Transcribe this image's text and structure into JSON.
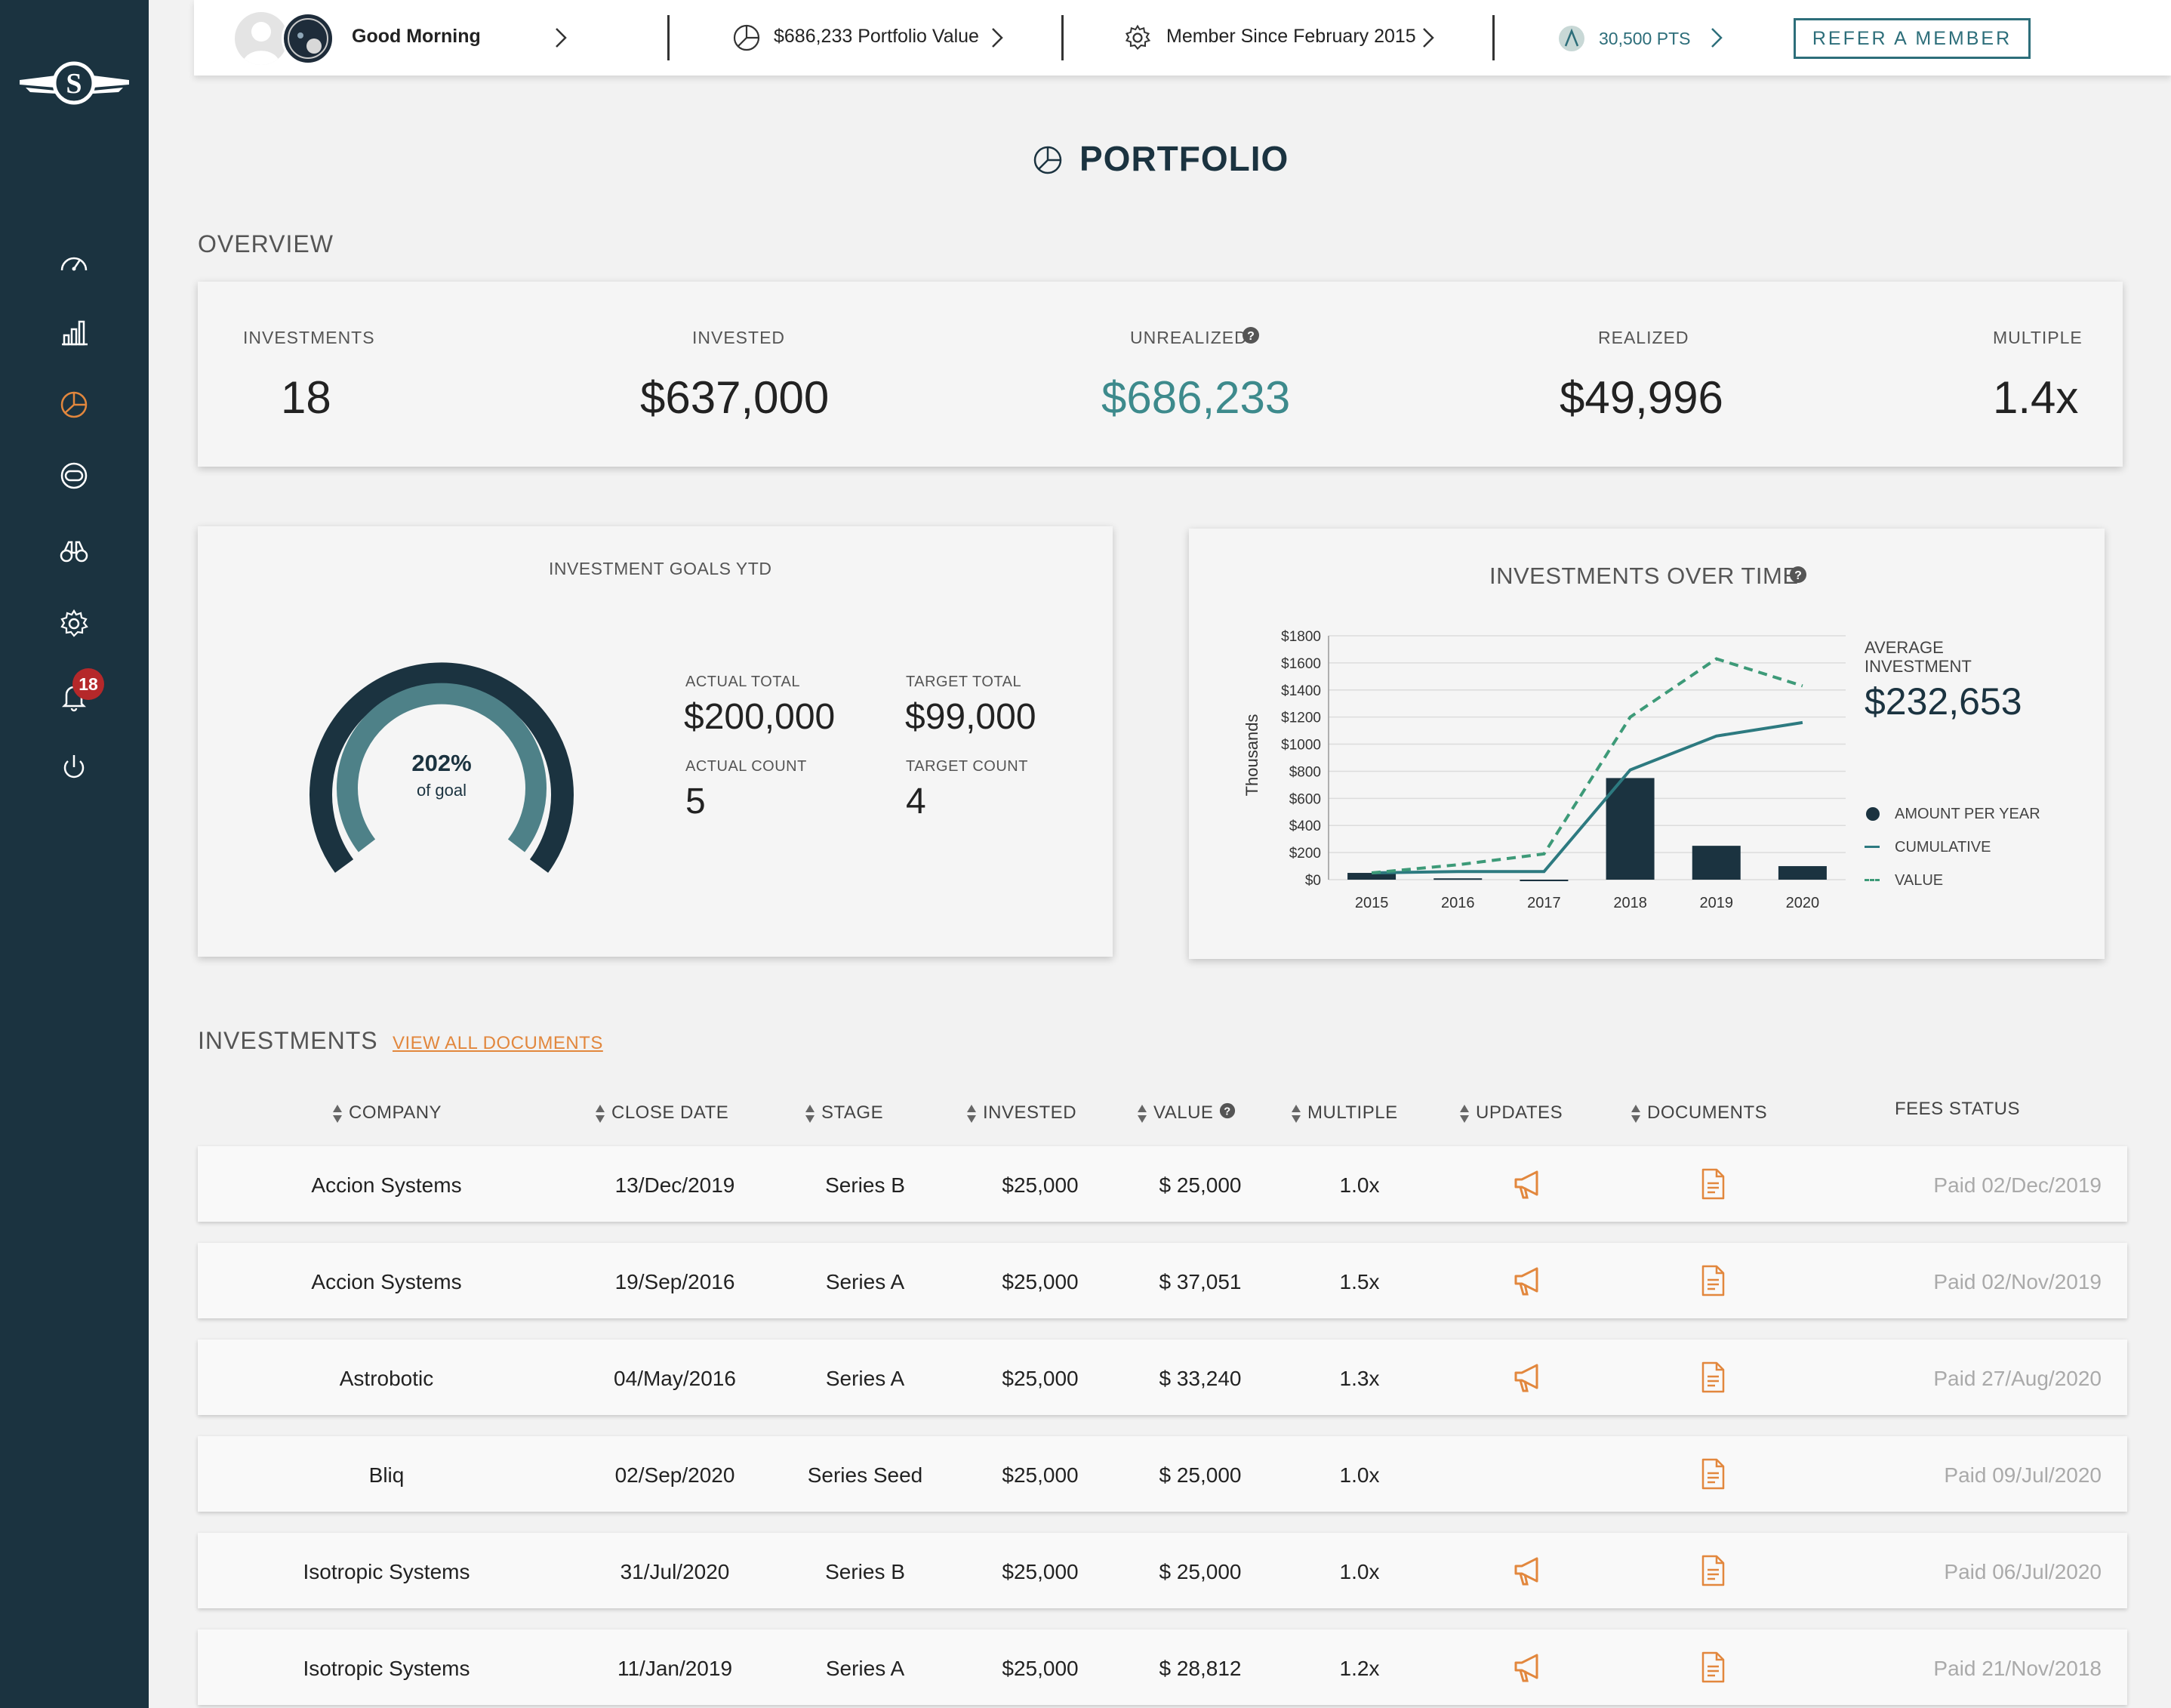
{
  "topbar": {
    "greeting": "Good Morning",
    "portfolio_value": "$686,233 Portfolio Value",
    "member_since": "Member Since February 2015",
    "points": "30,500 PTS",
    "refer_label": "REFER A MEMBER"
  },
  "sidebar": {
    "items": [
      "dashboard-icon",
      "analytics-icon",
      "portfolio-icon",
      "helmet-icon",
      "binoculars-icon",
      "settings-icon",
      "bell-icon",
      "power-icon"
    ],
    "notification_count": "18"
  },
  "page": {
    "title": "PORTFOLIO"
  },
  "overview": {
    "title": "OVERVIEW",
    "investments_label": "INVESTMENTS",
    "investments_value": "18",
    "invested_label": "INVESTED",
    "invested_value": "$637,000",
    "unrealized_label": "UNREALIZED",
    "unrealized_value": "$686,233",
    "realized_label": "REALIZED",
    "realized_value": "$49,996",
    "multiple_label": "MULTIPLE",
    "multiple_value": "1.4x"
  },
  "goals": {
    "title": "INVESTMENT GOALS YTD",
    "percent": "202%",
    "percent_sub": "of goal",
    "actual_total_label": "ACTUAL TOTAL",
    "actual_total": "$200,000",
    "target_total_label": "TARGET TOTAL",
    "target_total": "$99,000",
    "actual_count_label": "ACTUAL COUNT",
    "actual_count": "5",
    "target_count_label": "TARGET COUNT",
    "target_count": "4"
  },
  "chart_data": {
    "type": "bar",
    "title": "INVESTMENTS OVER TIME",
    "ylabel": "Thousands",
    "ylim": [
      0,
      1800
    ],
    "yticks": [
      "$0",
      "$200",
      "$400",
      "$600",
      "$800",
      "$1000",
      "$1200",
      "$1400",
      "$1600",
      "$1800"
    ],
    "categories": [
      "2015",
      "2016",
      "2017",
      "2018",
      "2019",
      "2020"
    ],
    "series": [
      {
        "name": "AMOUNT PER YEAR",
        "kind": "bar",
        "color": "#1b3340",
        "values": [
          50,
          10,
          0,
          750,
          250,
          100
        ]
      },
      {
        "name": "CUMULATIVE",
        "kind": "line",
        "color": "#2d7a80",
        "values": [
          50,
          60,
          60,
          810,
          1060,
          1160
        ]
      },
      {
        "name": "VALUE",
        "kind": "dashed-line",
        "color": "#3d9a78",
        "values": [
          50,
          110,
          190,
          1200,
          1630,
          1430
        ]
      }
    ],
    "average_label": "AVERAGE INVESTMENT",
    "average_value": "$232,653"
  },
  "investments": {
    "title": "INVESTMENTS",
    "view_all": "VIEW ALL DOCUMENTS",
    "columns": [
      "COMPANY",
      "CLOSE DATE",
      "STAGE",
      "INVESTED",
      "VALUE",
      "MULTIPLE",
      "UPDATES",
      "DOCUMENTS",
      "FEES STATUS"
    ],
    "rows": [
      {
        "company": "Accion Systems",
        "close_date": "13/Dec/2019",
        "stage": "Series B",
        "invested": "$25,000",
        "value": "$ 25,000",
        "multiple": "1.0x",
        "updates": true,
        "fees": "Paid 02/Dec/2019"
      },
      {
        "company": "Accion Systems",
        "close_date": "19/Sep/2016",
        "stage": "Series A",
        "invested": "$25,000",
        "value": "$ 37,051",
        "multiple": "1.5x",
        "updates": true,
        "fees": "Paid 02/Nov/2019"
      },
      {
        "company": "Astrobotic",
        "close_date": "04/May/2016",
        "stage": "Series A",
        "invested": "$25,000",
        "value": "$ 33,240",
        "multiple": "1.3x",
        "updates": true,
        "fees": "Paid 27/Aug/2020"
      },
      {
        "company": "Bliq",
        "close_date": "02/Sep/2020",
        "stage": "Series Seed",
        "invested": "$25,000",
        "value": "$ 25,000",
        "multiple": "1.0x",
        "updates": false,
        "fees": "Paid 09/Jul/2020"
      },
      {
        "company": "Isotropic Systems",
        "close_date": "31/Jul/2020",
        "stage": "Series B",
        "invested": "$25,000",
        "value": "$ 25,000",
        "multiple": "1.0x",
        "updates": true,
        "fees": "Paid 06/Jul/2020"
      },
      {
        "company": "Isotropic Systems",
        "close_date": "11/Jan/2019",
        "stage": "Series A",
        "invested": "$25,000",
        "value": "$ 28,812",
        "multiple": "1.2x",
        "updates": true,
        "fees": "Paid 21/Nov/2018"
      }
    ]
  }
}
